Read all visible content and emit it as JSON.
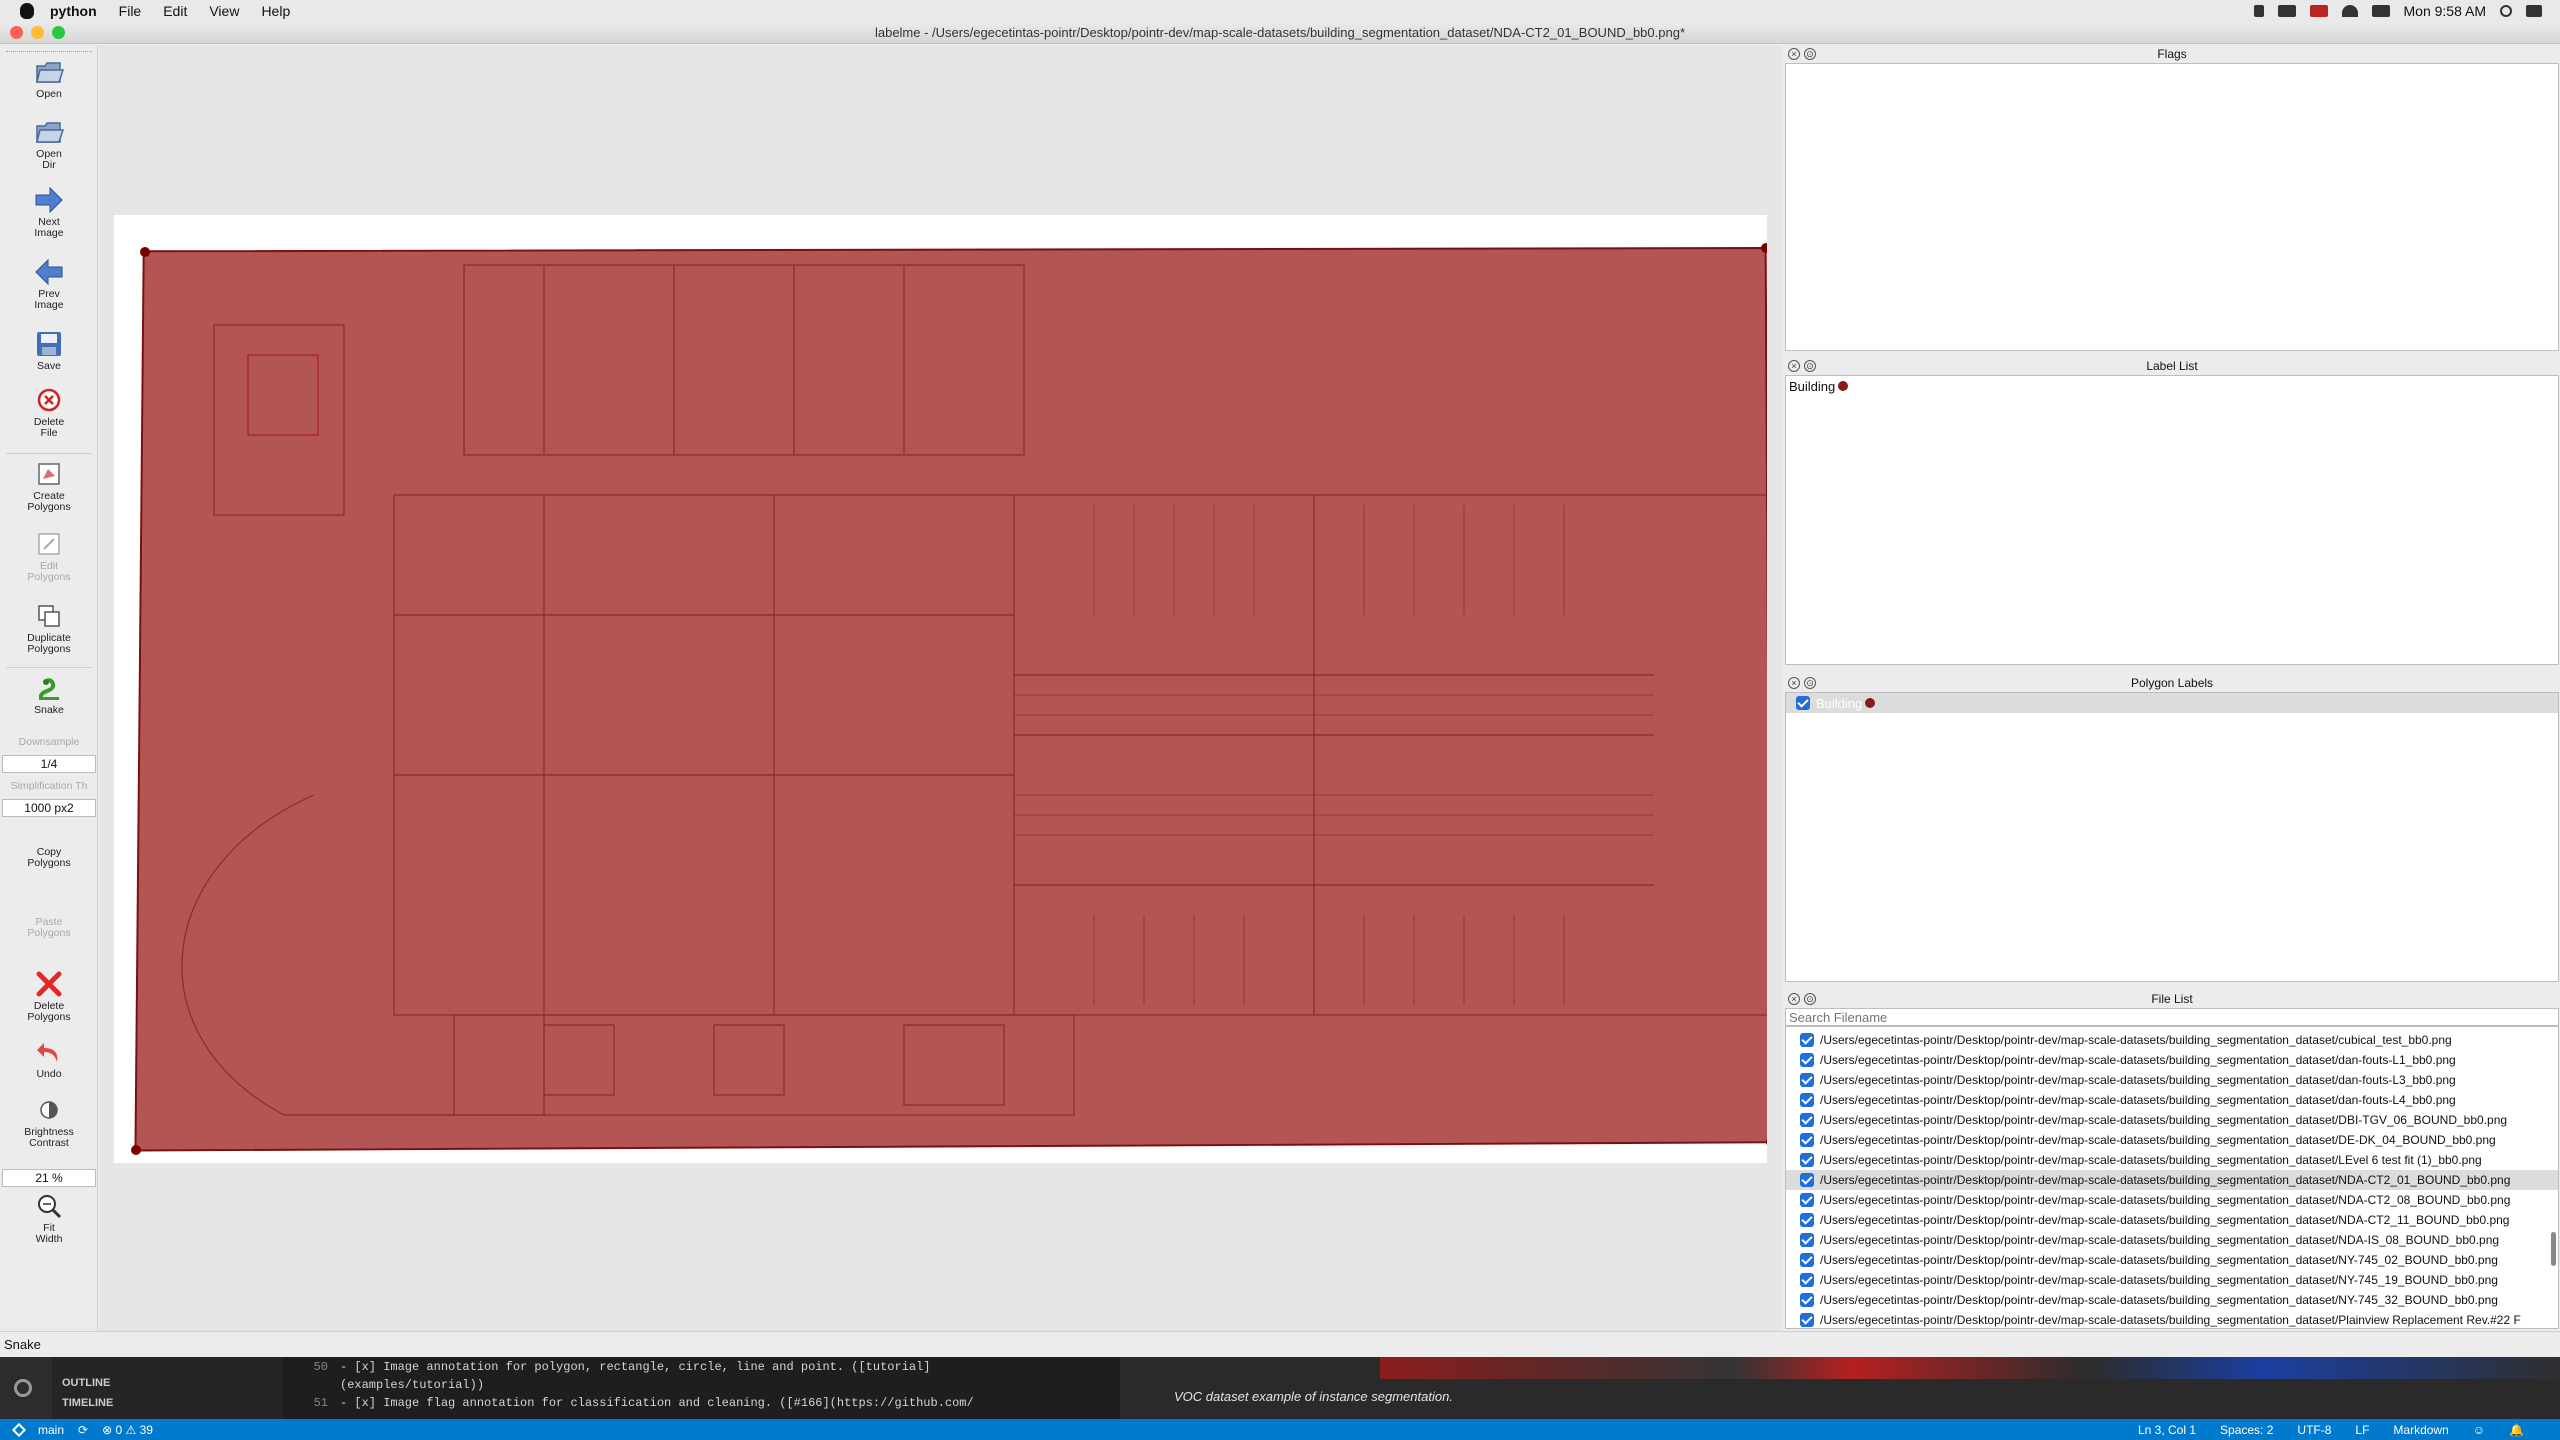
{
  "menubar": {
    "app": "python",
    "items": [
      "File",
      "Edit",
      "View",
      "Help"
    ],
    "clock": "Mon 9:58 AM"
  },
  "window": {
    "title": "labelme - /Users/egecetintas-pointr/Desktop/pointr-dev/map-scale-datasets/building_segmentation_dataset/NDA-CT2_01_BOUND_bb0.png*"
  },
  "toolbar": {
    "open": "Open",
    "open_dir": "Open\nDir",
    "next_image": "Next\nImage",
    "prev_image": "Prev\nImage",
    "save": "Save",
    "delete_file": "Delete\nFile",
    "create_polygons": "Create\nPolygons",
    "edit_polygons": "Edit\nPolygons",
    "duplicate_polygons": "Duplicate\nPolygons",
    "snake": "Snake",
    "downsample_label": "Downsample",
    "downsample_value": "1/4",
    "simplification_label": "Simplification Th",
    "simplification_value": "1000 px2",
    "copy_polygons": "Copy\nPolygons",
    "paste_polygons": "Paste\nPolygons",
    "delete_polygons": "Delete\nPolygons",
    "undo": "Undo",
    "brightness_contrast": "Brightness\nContrast",
    "zoom_value": "21 %",
    "fit_width": "Fit\nWidth"
  },
  "docks": {
    "flags_title": "Flags",
    "label_list_title": "Label List",
    "label_list_items": [
      {
        "name": "Building",
        "color": "#8b1a1a"
      }
    ],
    "polygon_labels_title": "Polygon Labels",
    "polygon_labels_items": [
      {
        "name": "Building",
        "color": "#8b1a1a"
      }
    ],
    "file_list_title": "File List",
    "search_placeholder": "Search Filename",
    "files": [
      "/Users/egecetintas-pointr/Desktop/pointr-dev/map-scale-datasets/building_segmentation_dataset/cubical_test_bb0.png",
      "/Users/egecetintas-pointr/Desktop/pointr-dev/map-scale-datasets/building_segmentation_dataset/dan-fouts-L1_bb0.png",
      "/Users/egecetintas-pointr/Desktop/pointr-dev/map-scale-datasets/building_segmentation_dataset/dan-fouts-L3_bb0.png",
      "/Users/egecetintas-pointr/Desktop/pointr-dev/map-scale-datasets/building_segmentation_dataset/dan-fouts-L4_bb0.png",
      "/Users/egecetintas-pointr/Desktop/pointr-dev/map-scale-datasets/building_segmentation_dataset/DBI-TGV_06_BOUND_bb0.png",
      "/Users/egecetintas-pointr/Desktop/pointr-dev/map-scale-datasets/building_segmentation_dataset/DE-DK_04_BOUND_bb0.png",
      "/Users/egecetintas-pointr/Desktop/pointr-dev/map-scale-datasets/building_segmentation_dataset/LEvel 6 test fit (1)_bb0.png",
      "/Users/egecetintas-pointr/Desktop/pointr-dev/map-scale-datasets/building_segmentation_dataset/NDA-CT2_01_BOUND_bb0.png",
      "/Users/egecetintas-pointr/Desktop/pointr-dev/map-scale-datasets/building_segmentation_dataset/NDA-CT2_08_BOUND_bb0.png",
      "/Users/egecetintas-pointr/Desktop/pointr-dev/map-scale-datasets/building_segmentation_dataset/NDA-CT2_11_BOUND_bb0.png",
      "/Users/egecetintas-pointr/Desktop/pointr-dev/map-scale-datasets/building_segmentation_dataset/NDA-IS_08_BOUND_bb0.png",
      "/Users/egecetintas-pointr/Desktop/pointr-dev/map-scale-datasets/building_segmentation_dataset/NY-745_02_BOUND_bb0.png",
      "/Users/egecetintas-pointr/Desktop/pointr-dev/map-scale-datasets/building_segmentation_dataset/NY-745_19_BOUND_bb0.png",
      "/Users/egecetintas-pointr/Desktop/pointr-dev/map-scale-datasets/building_segmentation_dataset/NY-745_32_BOUND_bb0.png",
      "/Users/egecetintas-pointr/Desktop/pointr-dev/map-scale-datasets/building_segmentation_dataset/Plainview Replacement Rev.#22 F"
    ],
    "selected_file_index": 7
  },
  "status_bar": {
    "text": "Snake"
  },
  "background_editor": {
    "sidebar_outline": "OUTLINE",
    "sidebar_timeline": "TIMELINE",
    "line_numbers": [
      "50",
      "",
      "51"
    ],
    "code_lines": [
      "- [x] Image annotation for polygon, rectangle, circle, line and point. ([tutorial]",
      "(examples/tutorial))",
      "- [x] Image flag annotation for classification and cleaning. ([#166](https://github.com/"
    ],
    "preview_caption": "VOC dataset example of instance segmentation.",
    "git_branch": "main",
    "problems": "⊗ 0 ⚠ 39",
    "cursor": "Ln 3, Col 1",
    "spaces": "Spaces: 2",
    "encoding": "UTF-8",
    "eol": "LF",
    "language": "Markdown"
  }
}
